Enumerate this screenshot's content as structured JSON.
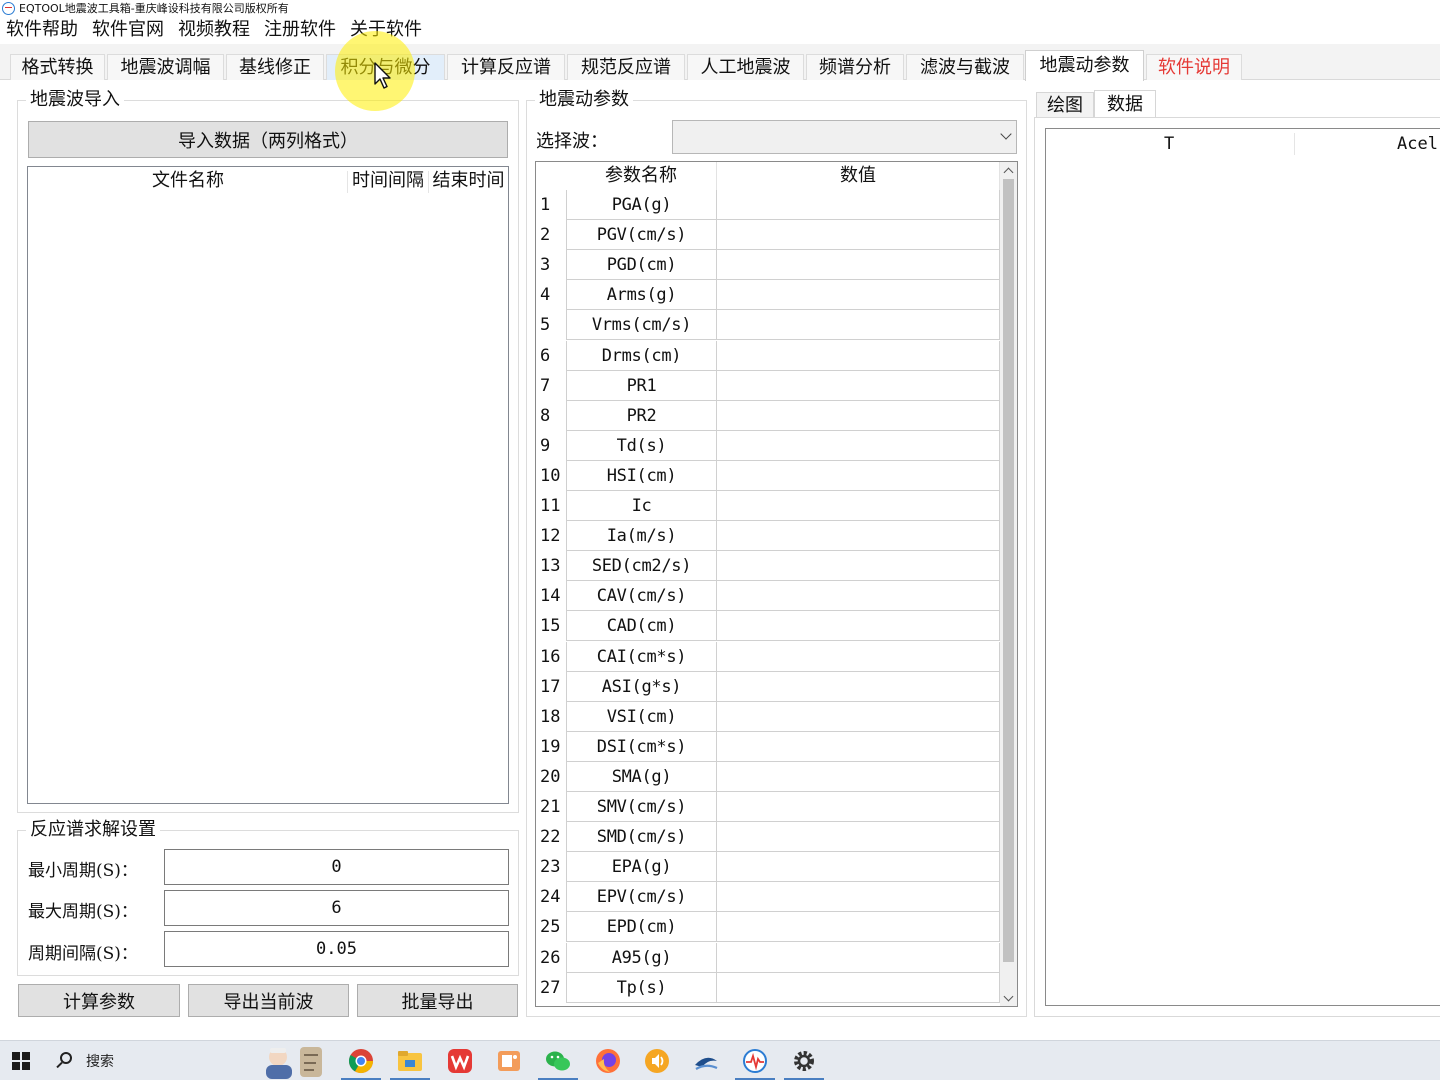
{
  "window": {
    "title": "EQTOOL地震波工具箱-重庆峰设科技有限公司版权所有"
  },
  "menu": [
    "软件帮助",
    "软件官网",
    "视频教程",
    "注册软件",
    "关于软件"
  ],
  "tabs": [
    "格式转换",
    "地震波调幅",
    "基线修正",
    "积分与微分",
    "计算反应谱",
    "规范反应谱",
    "人工地震波",
    "频谱分析",
    "滤波与截波",
    "地震动参数",
    "软件说明"
  ],
  "import_group": {
    "title": "地震波导入",
    "import_button": "导入数据（两列格式）",
    "columns": [
      "文件名称",
      "时间间隔",
      "结束时间"
    ]
  },
  "spectrum_settings": {
    "title": "反应谱求解设置",
    "min_period_label": "最小周期(S)：",
    "min_period_value": "0",
    "max_period_label": "最大周期(S)：",
    "max_period_value": "6",
    "interval_label": "周期间隔(S)：",
    "interval_value": "0.05"
  },
  "actions": {
    "calc": "计算参数",
    "export_current": "导出当前波",
    "batch_export": "批量导出"
  },
  "params_group": {
    "title": "地震动参数",
    "select_label": "选择波：",
    "select_value": "",
    "columns": [
      "参数名称",
      "数值"
    ],
    "rows": [
      {
        "n": "1",
        "name": "PGA(g)",
        "value": ""
      },
      {
        "n": "2",
        "name": "PGV(cm/s)",
        "value": ""
      },
      {
        "n": "3",
        "name": "PGD(cm)",
        "value": ""
      },
      {
        "n": "4",
        "name": "Arms(g)",
        "value": ""
      },
      {
        "n": "5",
        "name": "Vrms(cm/s)",
        "value": ""
      },
      {
        "n": "6",
        "name": "Drms(cm)",
        "value": ""
      },
      {
        "n": "7",
        "name": "PR1",
        "value": ""
      },
      {
        "n": "8",
        "name": "PR2",
        "value": ""
      },
      {
        "n": "9",
        "name": "Td(s)",
        "value": ""
      },
      {
        "n": "10",
        "name": "HSI(cm)",
        "value": ""
      },
      {
        "n": "11",
        "name": "Ic",
        "value": ""
      },
      {
        "n": "12",
        "name": "Ia(m/s)",
        "value": ""
      },
      {
        "n": "13",
        "name": "SED(cm2/s)",
        "value": ""
      },
      {
        "n": "14",
        "name": "CAV(cm/s)",
        "value": ""
      },
      {
        "n": "15",
        "name": "CAD(cm)",
        "value": ""
      },
      {
        "n": "16",
        "name": "CAI(cm*s)",
        "value": ""
      },
      {
        "n": "17",
        "name": "ASI(g*s)",
        "value": ""
      },
      {
        "n": "18",
        "name": "VSI(cm)",
        "value": ""
      },
      {
        "n": "19",
        "name": "DSI(cm*s)",
        "value": ""
      },
      {
        "n": "20",
        "name": "SMA(g)",
        "value": ""
      },
      {
        "n": "21",
        "name": "SMV(cm/s)",
        "value": ""
      },
      {
        "n": "22",
        "name": "SMD(cm/s)",
        "value": ""
      },
      {
        "n": "23",
        "name": "EPA(g)",
        "value": ""
      },
      {
        "n": "24",
        "name": "EPV(cm/s)",
        "value": ""
      },
      {
        "n": "25",
        "name": "EPD(cm)",
        "value": ""
      },
      {
        "n": "26",
        "name": "A95(g)",
        "value": ""
      },
      {
        "n": "27",
        "name": "Tp(s)",
        "value": ""
      }
    ]
  },
  "right_panel": {
    "tabs": [
      "绘图",
      "数据"
    ],
    "columns": [
      "T",
      "Acel"
    ]
  },
  "taskbar": {
    "search_text": "搜索"
  },
  "colors": {
    "accent_red": "#e53935",
    "tab_hover": "#e2eefa",
    "taskbar_underline": "#4a7fc1"
  }
}
